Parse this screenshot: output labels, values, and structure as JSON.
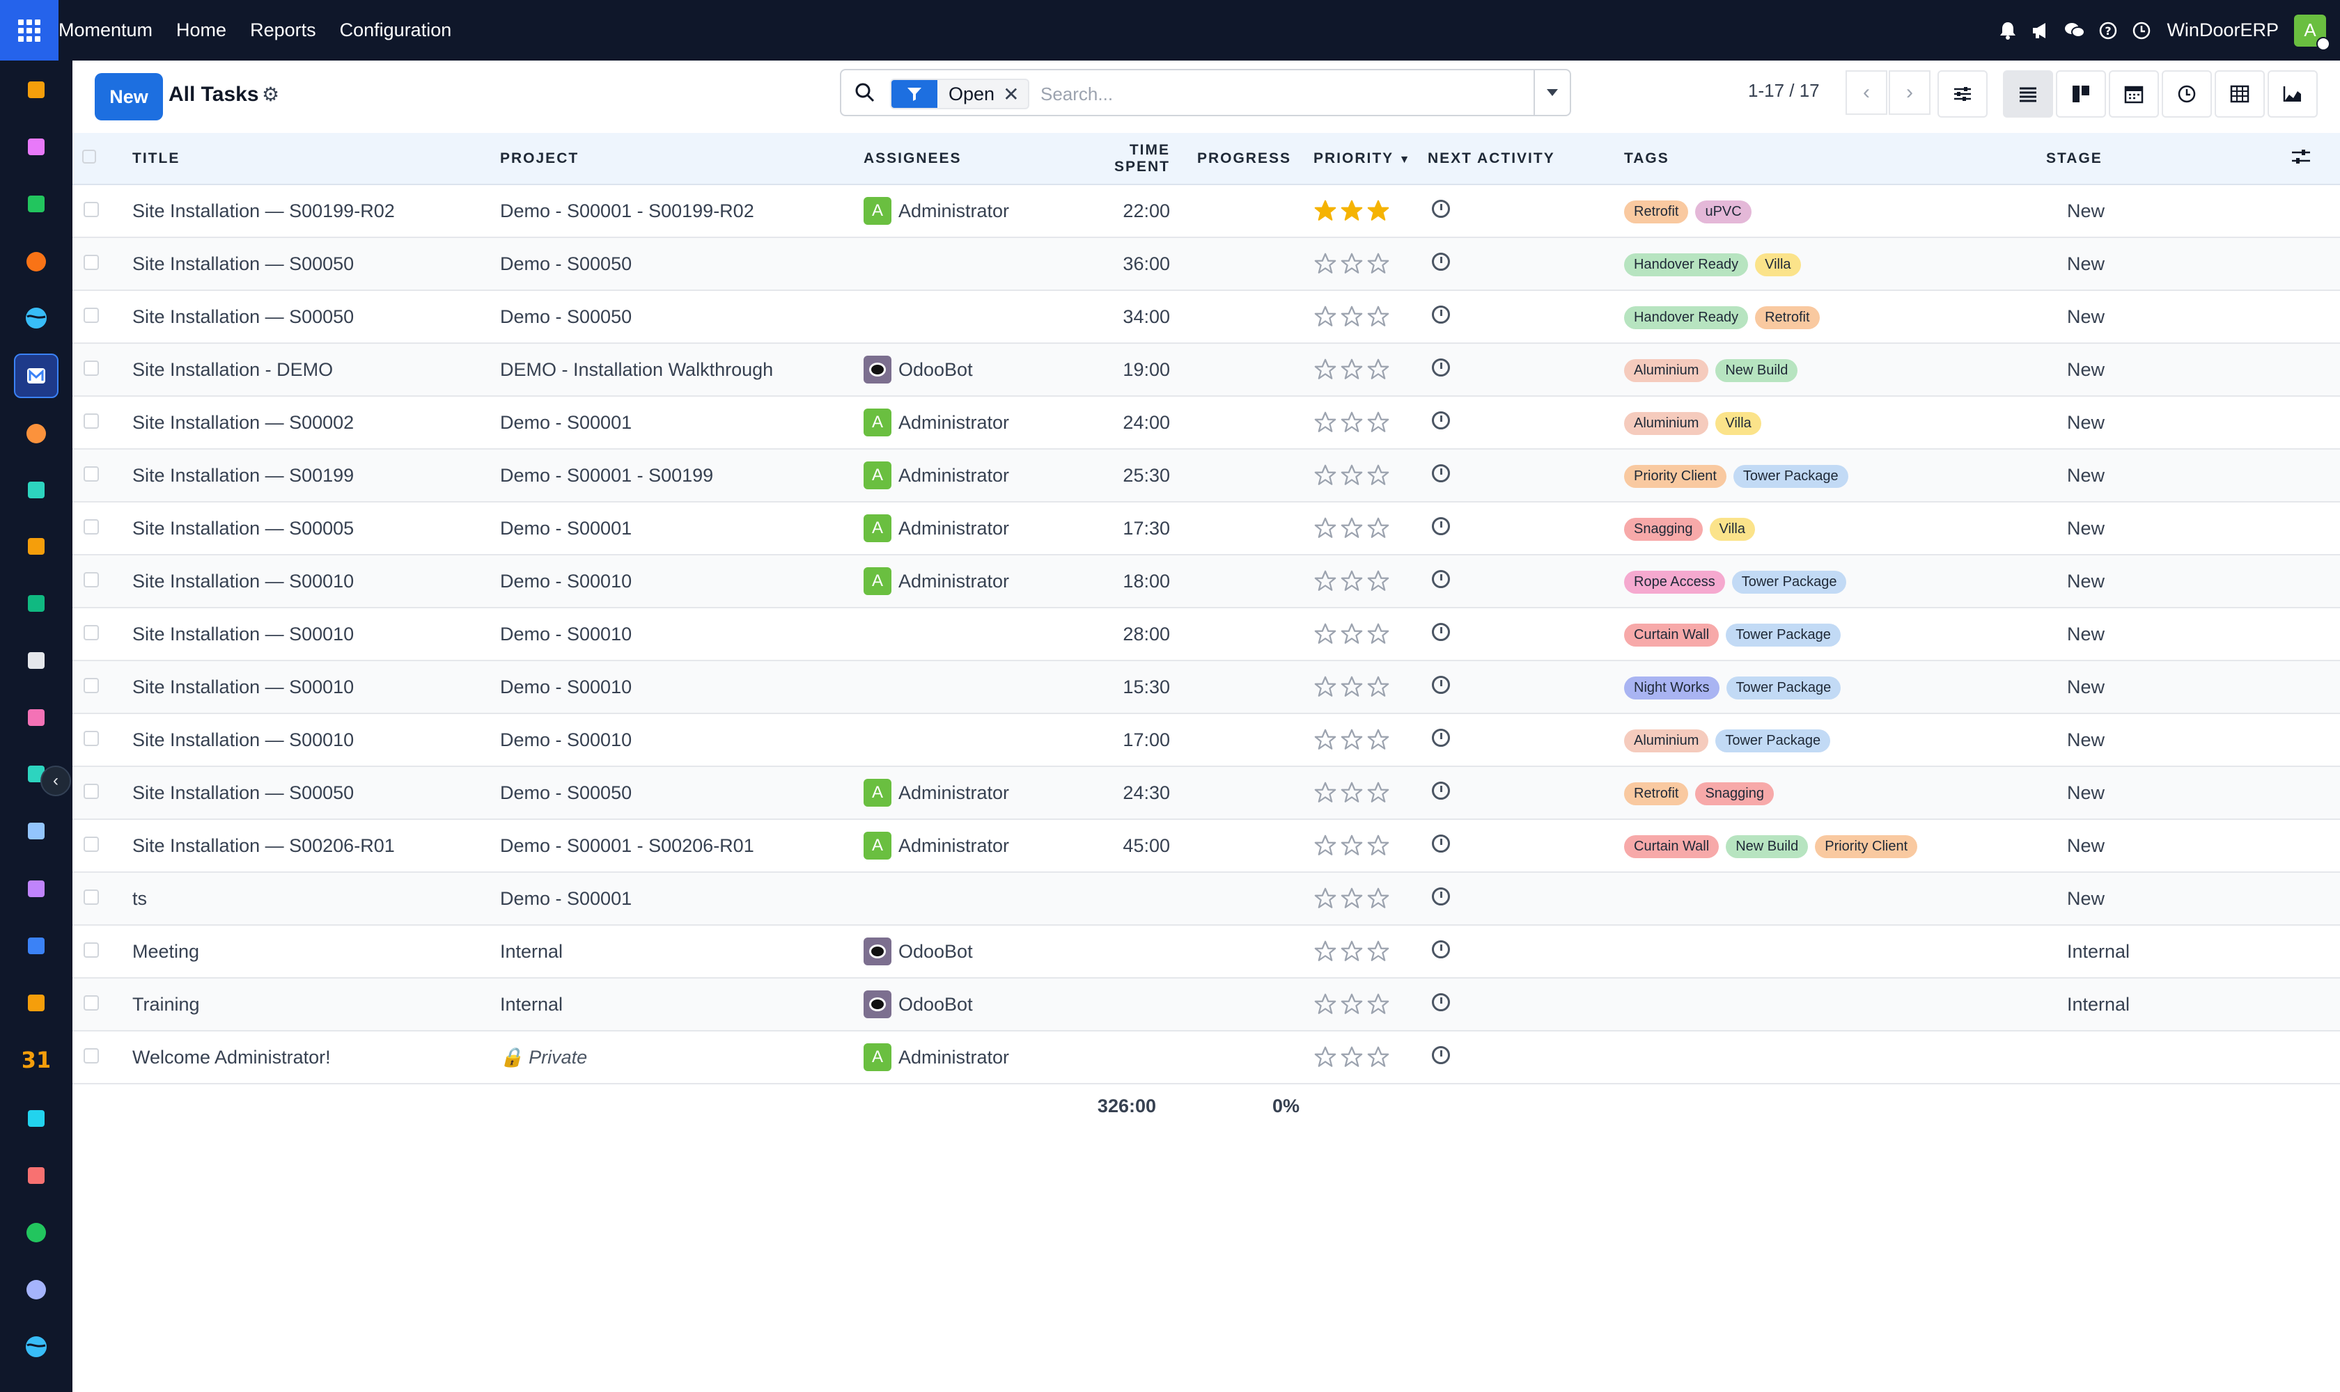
{
  "app": {
    "brand": "Momentum",
    "menu": [
      "Home",
      "Reports",
      "Configuration"
    ],
    "company": "WinDoorERP",
    "user_initial": "A"
  },
  "control": {
    "new_label": "New",
    "title": "All Tasks",
    "facet_label": "Open",
    "search_placeholder": "Search...",
    "pager": "1-17 / 17"
  },
  "columns": {
    "title": "TITLE",
    "project": "PROJECT",
    "assignees": "ASSIGNEES",
    "time_spent": "TIME SPENT",
    "progress": "PROGRESS",
    "priority": "PRIORITY",
    "next_activity": "NEXT ACTIVITY",
    "tags": "TAGS",
    "stage": "STAGE"
  },
  "tag_colors": {
    "Retrofit": "#f9c9a0",
    "uPVC": "#e4b8d8",
    "Handover Ready": "#b7e4c0",
    "Villa": "#fbe38a",
    "Aluminium": "#f5cbbd",
    "New Build": "#b7e4c0",
    "Priority Client": "#f9c9a0",
    "Tower Package": "#c2daf5",
    "Snagging": "#f7a9a9",
    "Rope Access": "#f5a9cf",
    "Curtain Wall": "#f7a9a9",
    "Night Works": "#a9b4f2"
  },
  "rows": [
    {
      "title": "Site Installation — S00199-R02",
      "project": "Demo - S00001 - S00199-R02",
      "assignee": "Administrator",
      "assignee_type": "admin",
      "time": "22:00",
      "priority": 3,
      "tags": [
        "Retrofit",
        "uPVC"
      ],
      "state": "green",
      "stage": "New"
    },
    {
      "title": "Site Installation — S00050",
      "project": "Demo - S00050",
      "assignee": "",
      "assignee_type": "",
      "time": "36:00",
      "priority": 0,
      "tags": [
        "Handover Ready",
        "Villa"
      ],
      "state": "grey",
      "stage": "New"
    },
    {
      "title": "Site Installation — S00050",
      "project": "Demo - S00050",
      "assignee": "",
      "assignee_type": "",
      "time": "34:00",
      "priority": 0,
      "tags": [
        "Handover Ready",
        "Retrofit"
      ],
      "state": "grey",
      "stage": "New"
    },
    {
      "title": "Site Installation - DEMO",
      "project": "DEMO - Installation Walkthrough",
      "assignee": "OdooBot",
      "assignee_type": "bot",
      "time": "19:00",
      "priority": 0,
      "tags": [
        "Aluminium",
        "New Build"
      ],
      "state": "grey",
      "stage": "New"
    },
    {
      "title": "Site Installation — S00002",
      "project": "Demo - S00001",
      "assignee": "Administrator",
      "assignee_type": "admin",
      "time": "24:00",
      "priority": 0,
      "tags": [
        "Aluminium",
        "Villa"
      ],
      "state": "grey",
      "stage": "New"
    },
    {
      "title": "Site Installation — S00199",
      "project": "Demo - S00001 - S00199",
      "assignee": "Administrator",
      "assignee_type": "admin",
      "time": "25:30",
      "priority": 0,
      "tags": [
        "Priority Client",
        "Tower Package"
      ],
      "state": "grey",
      "stage": "New"
    },
    {
      "title": "Site Installation — S00005",
      "project": "Demo - S00001",
      "assignee": "Administrator",
      "assignee_type": "admin",
      "time": "17:30",
      "priority": 0,
      "tags": [
        "Snagging",
        "Villa"
      ],
      "state": "grey",
      "stage": "New"
    },
    {
      "title": "Site Installation — S00010",
      "project": "Demo - S00010",
      "assignee": "Administrator",
      "assignee_type": "admin",
      "time": "18:00",
      "priority": 0,
      "tags": [
        "Rope Access",
        "Tower Package"
      ],
      "state": "grey",
      "stage": "New"
    },
    {
      "title": "Site Installation — S00010",
      "project": "Demo - S00010",
      "assignee": "",
      "assignee_type": "",
      "time": "28:00",
      "priority": 0,
      "tags": [
        "Curtain Wall",
        "Tower Package"
      ],
      "state": "grey",
      "stage": "New"
    },
    {
      "title": "Site Installation — S00010",
      "project": "Demo - S00010",
      "assignee": "",
      "assignee_type": "",
      "time": "15:30",
      "priority": 0,
      "tags": [
        "Night Works",
        "Tower Package"
      ],
      "state": "grey",
      "stage": "New"
    },
    {
      "title": "Site Installation — S00010",
      "project": "Demo - S00010",
      "assignee": "",
      "assignee_type": "",
      "time": "17:00",
      "priority": 0,
      "tags": [
        "Aluminium",
        "Tower Package"
      ],
      "state": "grey",
      "stage": "New"
    },
    {
      "title": "Site Installation — S00050",
      "project": "Demo - S00050",
      "assignee": "Administrator",
      "assignee_type": "admin",
      "time": "24:30",
      "priority": 0,
      "tags": [
        "Retrofit",
        "Snagging"
      ],
      "state": "grey",
      "stage": "New"
    },
    {
      "title": "Site Installation — S00206-R01",
      "project": "Demo - S00001 - S00206-R01",
      "assignee": "Administrator",
      "assignee_type": "admin",
      "time": "45:00",
      "priority": 0,
      "tags": [
        "Curtain Wall",
        "New Build",
        "Priority Client"
      ],
      "state": "grey",
      "stage": "New"
    },
    {
      "title": "ts",
      "project": "Demo - S00001",
      "assignee": "",
      "assignee_type": "",
      "time": "",
      "priority": 0,
      "tags": [],
      "state": "grey",
      "stage": "New"
    },
    {
      "title": "Meeting",
      "project": "Internal",
      "assignee": "OdooBot",
      "assignee_type": "bot",
      "time": "",
      "priority": 0,
      "tags": [],
      "state": "grey",
      "stage": "Internal"
    },
    {
      "title": "Training",
      "project": "Internal",
      "assignee": "OdooBot",
      "assignee_type": "bot",
      "time": "",
      "priority": 0,
      "tags": [],
      "state": "grey",
      "stage": "Internal"
    },
    {
      "title": "Welcome Administrator!",
      "project": "🔒 Private",
      "assignee": "Administrator",
      "assignee_type": "admin",
      "time": "",
      "priority": 0,
      "tags": [],
      "state": "grey",
      "stage": "",
      "private": true
    }
  ],
  "totals": {
    "time": "326:00",
    "progress": "0%"
  },
  "dock_apps": [
    "analytics-icon",
    "puzzle-icon",
    "contacts-icon",
    "chat-bubble-icon",
    "wave-icon",
    "mail-icon",
    "chat-bubble-icon",
    "shield-icon",
    "analytics-icon",
    "contacts-icon",
    "cube-icon",
    "puzzle-icon",
    "check-icon",
    "book-icon",
    "box-icon",
    "invoice-icon",
    "people-icon",
    "calendar-icon",
    "sign-icon",
    "dashboard-icon",
    "whatsapp-icon",
    "gauge-icon",
    "wave-icon"
  ]
}
